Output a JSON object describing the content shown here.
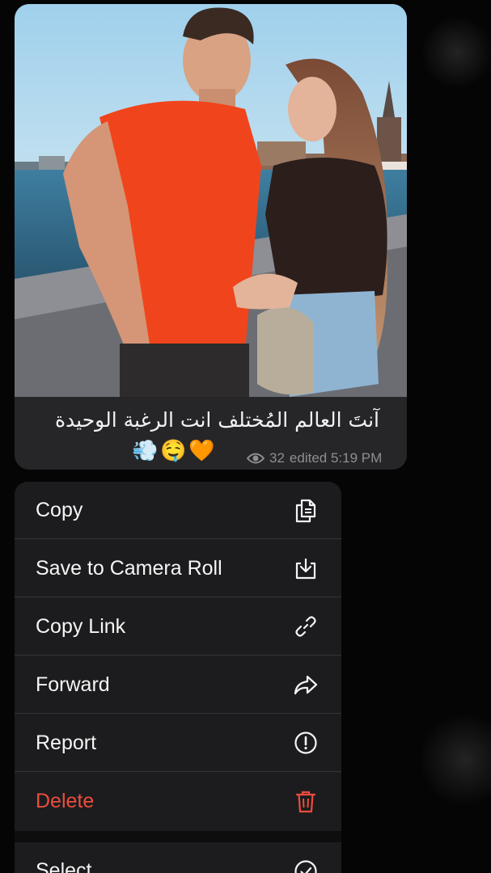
{
  "message": {
    "caption": "آنتَ العالم المُختلف انت الرغبة الوحيدة",
    "emojis": [
      {
        "glyph": "🧡",
        "name": "orange-heart-icon"
      },
      {
        "glyph": "🤤",
        "name": "drooling-face-icon"
      },
      {
        "glyph": "💨",
        "name": "dash-icon"
      }
    ],
    "views": "32",
    "edited": "edited 5:19 PM",
    "eye_icon": "eye-icon"
  },
  "menu": {
    "items": [
      {
        "label": "Copy",
        "icon": "copy-icon"
      },
      {
        "label": "Save to Camera Roll",
        "icon": "download-icon"
      },
      {
        "label": "Copy Link",
        "icon": "link-icon"
      },
      {
        "label": "Forward",
        "icon": "forward-icon"
      },
      {
        "label": "Report",
        "icon": "report-icon"
      },
      {
        "label": "Delete",
        "icon": "trash-icon",
        "color": "#eb4d3d"
      }
    ],
    "secondary": [
      {
        "label": "Select",
        "icon": "checkmark-circle-icon"
      }
    ]
  },
  "colors": {
    "bubble": "#262628",
    "menu_bg": "#1c1c1e",
    "danger": "#eb4d3d",
    "meta": "#8e8e93"
  }
}
